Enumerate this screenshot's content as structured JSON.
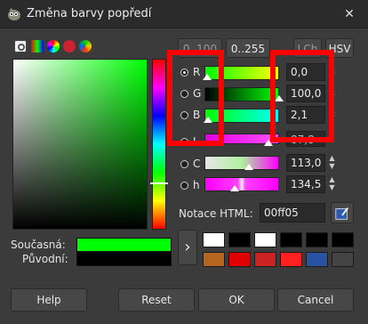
{
  "window": {
    "title": "Změna barvy popředí"
  },
  "scale_buttons": {
    "range_100": "0..100",
    "range_255": "0..255",
    "lch": "LCh",
    "hsv": "HSV"
  },
  "channels": [
    {
      "key": "R",
      "value": "0,0",
      "selected": true
    },
    {
      "key": "G",
      "value": "100,0",
      "selected": false
    },
    {
      "key": "B",
      "value": "2,1",
      "selected": false
    },
    {
      "key": "L",
      "value": "87,8",
      "selected": false
    },
    {
      "key": "C",
      "value": "113,0",
      "selected": false
    },
    {
      "key": "h",
      "value": "134,5",
      "selected": false
    }
  ],
  "html_notation": {
    "label": "Notace HTML:",
    "value": "00ff05"
  },
  "current": {
    "label": "Současná:",
    "color": "#00ff05"
  },
  "previous": {
    "label": "Původní:",
    "color": "#000000"
  },
  "history_arrow": "›",
  "history_colors": [
    "#ffffff",
    "#000000",
    "#ffffff",
    "#000000",
    "#000000",
    "#000000",
    "#b5651d",
    "#e00000",
    "#cc2222",
    "#ff2020",
    "#2952a3",
    "#444444"
  ],
  "buttons": {
    "help": "Help",
    "reset": "Reset",
    "ok": "OK",
    "cancel": "Cancel"
  }
}
